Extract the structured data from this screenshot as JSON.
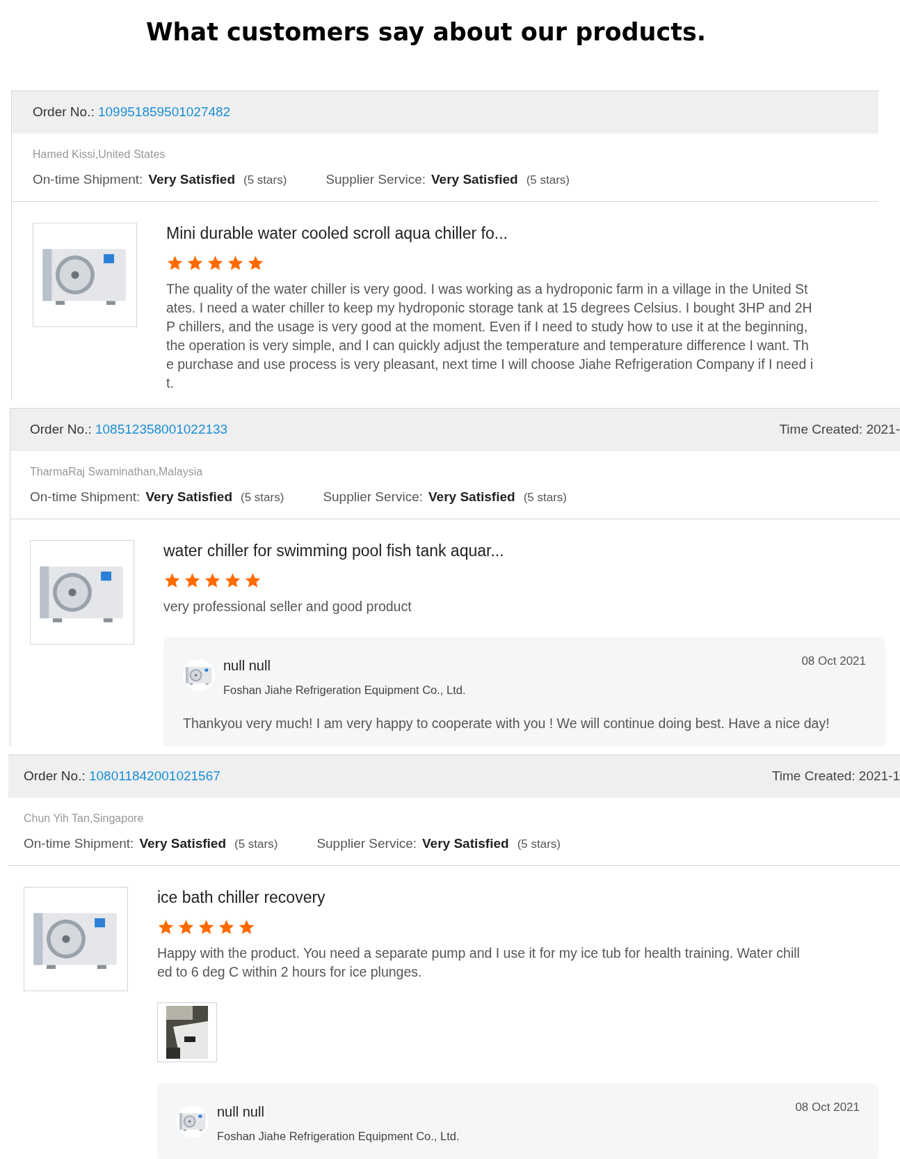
{
  "title": "What customers say about our products.",
  "reviews": [
    {
      "order_label": "Order No.:",
      "order_no": "109951859501027482",
      "buyer": "Hamed Kissi,United States",
      "ratings": [
        {
          "label": "On-time Shipment:",
          "value": "Very Satisfied",
          "count": "(5 stars)"
        },
        {
          "label": "Supplier Service:",
          "value": "Very Satisfied",
          "count": "(5 stars)"
        }
      ],
      "product_title": "Mini durable water cooled scroll aqua chiller fo...",
      "stars": 5,
      "text": "The quality of the water chiller is very good. I was working as a hydroponic farm in a village in the United States. I need a water chiller to keep my hydroponic storage tank at 15 degrees Celsius. I bought 3HP and 2HP chillers, and the usage is very good at the moment. Even if I need to study how to use it at the beginning, the operation is very simple, and I can quickly adjust the temperature and temperature difference I want. The purchase and use process is very pleasant, next time I will choose Jiahe Refrigeration Company if I need it."
    },
    {
      "order_label": "Order No.:",
      "order_no": "108512358001022133",
      "time_created": "Time Created: 2021-",
      "buyer": "TharmaRaj Swaminathan,Malaysia",
      "ratings": [
        {
          "label": "On-time Shipment:",
          "value": "Very Satisfied",
          "count": "(5 stars)"
        },
        {
          "label": "Supplier Service:",
          "value": "Very Satisfied",
          "count": "(5 stars)"
        }
      ],
      "product_title": "water chiller for swimming pool fish tank aquar...",
      "stars": 5,
      "text": "very professional seller and good product",
      "reply": {
        "name": "null null",
        "company": "Foshan Jiahe Refrigeration Equipment Co., Ltd.",
        "date": "08 Oct 2021",
        "message": "Thankyou very much!  I am very happy to cooperate with you ! We will continue doing best. Have a nice day!"
      }
    },
    {
      "order_label": "Order No.:",
      "order_no": "108011842001021567",
      "time_created": "Time Created: 2021-1",
      "buyer": "Chun Yih Tan,Singapore",
      "ratings": [
        {
          "label": "On-time Shipment:",
          "value": "Very Satisfied",
          "count": "(5 stars)"
        },
        {
          "label": "Supplier Service:",
          "value": "Very Satisfied",
          "count": "(5 stars)"
        }
      ],
      "product_title": "ice bath chiller recovery",
      "stars": 5,
      "text": "Happy with the product. You need a separate pump and I use it for my ice tub for health training. Water chilled to 6 deg C within 2 hours for ice plunges.",
      "photos": [
        {
          "kind": "picture"
        }
      ],
      "reply": {
        "name": "null null",
        "company": "Foshan Jiahe Refrigeration Equipment Co., Ltd.",
        "date": "08 Oct 2021"
      }
    }
  ]
}
